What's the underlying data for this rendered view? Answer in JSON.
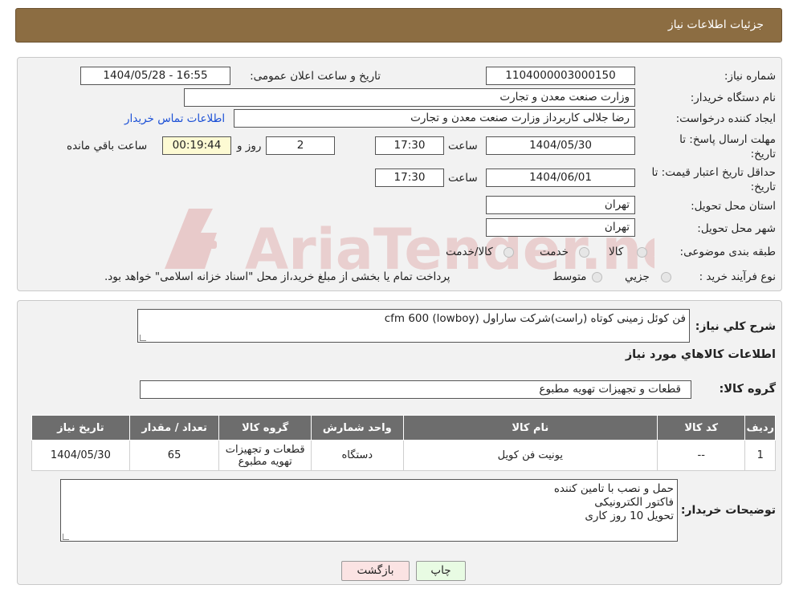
{
  "header": {
    "title": "جزئیات اطلاعات نیاز"
  },
  "info": {
    "need_number_label": "شماره نیاز:",
    "need_number": "1104000003000150",
    "announce_label": "تاریخ و ساعت اعلان عمومی:",
    "announce_value": "1404/05/28 - 16:55",
    "buyer_org_label": "نام دستگاه خريدار:",
    "buyer_org": "وزارت صنعت معدن و تجارت",
    "requester_label": "ايجاد کننده درخواست:",
    "requester": "رضا جلالی کاربرداز وزارت صنعت معدن و تجارت",
    "contact_link": "اطلاعات تماس خريدار",
    "deadline_label_1": "مهلت ارسال پاسخ: تا",
    "deadline_label_2": "تاريخ:",
    "deadline_date": "1404/05/30",
    "time_label": "ساعت",
    "deadline_time": "17:30",
    "days_value": "2",
    "days_label": "روز و",
    "remaining_time": "00:19:44",
    "remaining_label": "ساعت باقي مانده",
    "validity_label_1": "حداقل تاريخ اعتبار قيمت: تا",
    "validity_label_2": "تاريخ:",
    "validity_date": "1404/06/01",
    "validity_time": "17:30",
    "province_label": "استان محل تحويل:",
    "province": "تهران",
    "city_label": "شهر محل تحويل:",
    "city": "تهران",
    "category_label": "طبقه بندی موضوعی:",
    "category_options": [
      "کالا",
      "خدمت",
      "کالا/خدمت"
    ],
    "process_label": "نوع فرآيند خريد :",
    "process_options": [
      "جزيي",
      "متوسط"
    ],
    "process_note": "پرداخت تمام يا بخشی از مبلغ خريد،از محل \"اسناد خزانه اسلامی\" خواهد بود."
  },
  "watermark": {
    "text": "AriaTender.neT"
  },
  "details": {
    "summary_label": "شرح کلي نياز:",
    "summary": "فن کوئل زمینی کوتاه (راست)شرکت ساراول (lowboy) cfm 600",
    "items_heading": "اطلاعات کالاهاي مورد نياز",
    "group_label": "گروه کالا:",
    "group_value": "قطعات و تجهيزات تهويه مطبوع"
  },
  "table": {
    "headers": [
      "رديف",
      "کد کالا",
      "نام کالا",
      "واحد شمارش",
      "گروه کالا",
      "تعداد / مقدار",
      "تاريخ نياز"
    ],
    "rows": [
      [
        "1",
        "--",
        "یونیت فن کویل",
        "دستگاه",
        "قطعات و تجهيزات تهويه مطبوع",
        "65",
        "1404/05/30"
      ]
    ]
  },
  "notes": {
    "label": "توضيحات خريدار:",
    "lines": [
      "حمل و نصب با تامین کننده",
      "فاکتور الکترونیکی",
      "تحویل 10 روز کاری"
    ]
  },
  "buttons": {
    "print": "چاپ",
    "back": "بازگشت"
  },
  "colors": {
    "header_bg": "#8c6d42",
    "table_header_bg": "#6d6d6d",
    "link": "#1a4fd6",
    "back_btn_bg": "#fbe3e3",
    "print_btn_bg": "#e8fbe3"
  }
}
